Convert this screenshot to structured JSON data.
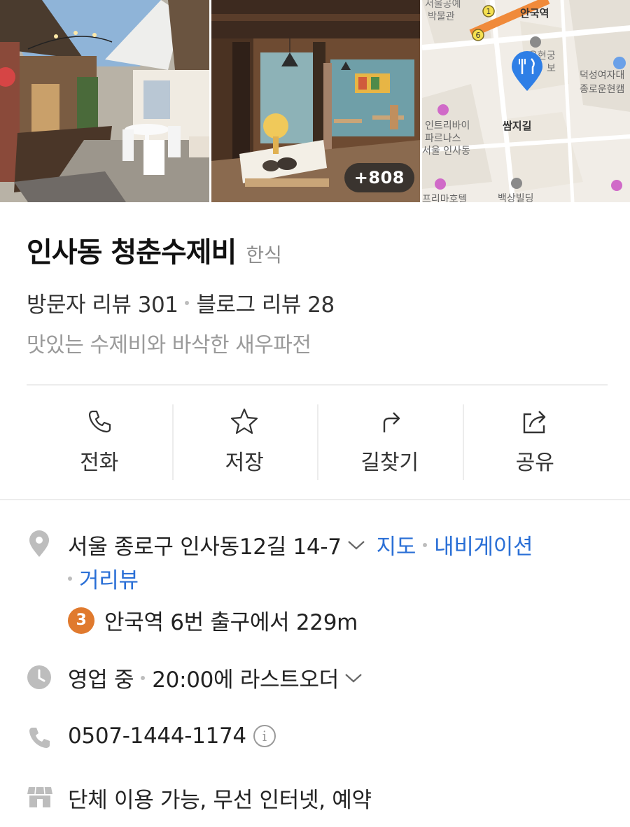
{
  "photos": {
    "more_count": "+808"
  },
  "map_labels": {
    "station": "안국역",
    "station_top": "서울공예",
    "museum": "박물관",
    "exit_1": "1",
    "exit_6": "6",
    "palace": "운현궁",
    "palace_suffix": "보",
    "school": "덕성여자대",
    "school2": "종로운현캠",
    "ssamziegil": "쌈지길",
    "hotel1": "인트리바이",
    "hotel2": "파르나스",
    "hotel3": "서울 인사동",
    "hotel4": "프리마호텔",
    "building": "백상빌딩"
  },
  "place": {
    "name": "인사동 청춘수제비",
    "category": "한식",
    "visitor_reviews": "방문자 리뷰 301",
    "blog_reviews": "블로그 리뷰 28",
    "description": "맛있는 수제비와 바삭한 새우파전"
  },
  "actions": {
    "call": "전화",
    "save": "저장",
    "directions": "길찾기",
    "share": "공유"
  },
  "address": {
    "text": "서울 종로구 인사동12길 14-7",
    "map_link": "지도",
    "navigation_link": "내비게이션",
    "streetview_link": "거리뷰"
  },
  "subway": {
    "line_number": "3",
    "text": "안국역 6번 출구에서 229m"
  },
  "hours": {
    "status": "영업 중",
    "last_order": "20:00에 라스트오더"
  },
  "phone": {
    "number": "0507-1444-1174",
    "info_symbol": "i"
  },
  "amenities": {
    "text": "단체 이용 가능, 무선 인터넷, 예약"
  },
  "colors": {
    "link": "#2a6fd6",
    "subway_line_3": "#e07a2e",
    "map_pin": "#2f7fe6"
  }
}
